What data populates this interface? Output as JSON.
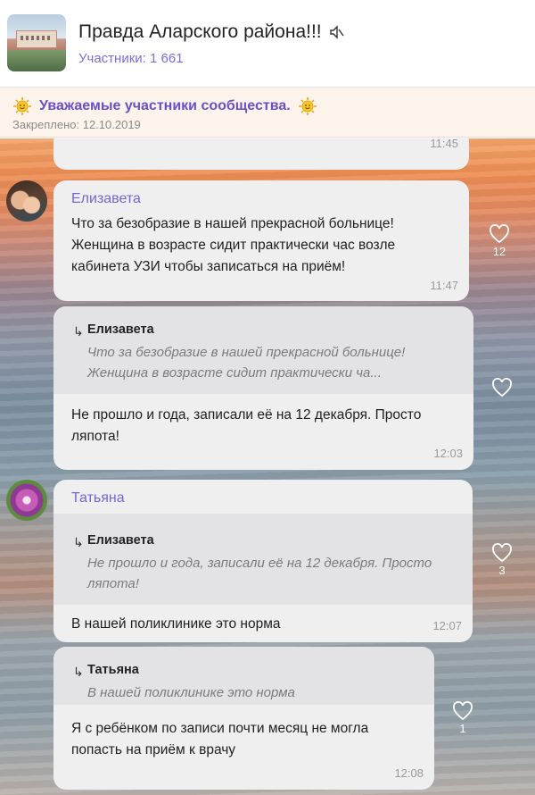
{
  "header": {
    "title": "Правда Аларского района!!!",
    "members": "Участники: 1 661"
  },
  "pinned": {
    "text": "Уважаемые участники сообщества.",
    "date": "Закреплено: 12.10.2019"
  },
  "messages": [
    {
      "time": "11:45"
    },
    {
      "author": "Елизавета",
      "text": "Что за безобразие в нашей прекрасной больнице! Женщина в возрасте сидит практически час возле кабинета УЗИ чтобы записаться на приём!",
      "time": "11:47",
      "likes": "12"
    },
    {
      "quote_author": "Елизавета",
      "quote_text": "Что за безобразие в нашей прекрасной больнице! Женщина в возрасте сидит практически ча...",
      "text": "Не прошло и года, записали её на 12 декабря. Просто ляпота!",
      "time": "12:03",
      "likes": ""
    },
    {
      "author": "Татьяна",
      "quote_author": "Елизавета",
      "quote_text": "Не прошло и года, записали её на 12 декабря. Просто ляпота!",
      "text": "В нашей поликлинике это норма",
      "time": "12:07",
      "likes": "3"
    },
    {
      "quote_author": "Татьяна",
      "quote_text": "В нашей поликлинике это норма",
      "text": "Я с ребёнком по записи почти месяц не могла попасть на приём к врачу",
      "time": "12:08",
      "likes": "1"
    }
  ],
  "colors": {
    "accent": "#7a63d4",
    "bubble": "#efefef",
    "quote": "#e3e3e6"
  },
  "icons": [
    "mute-icon",
    "sun-icon",
    "reply-arrow-icon",
    "heart-icon"
  ]
}
